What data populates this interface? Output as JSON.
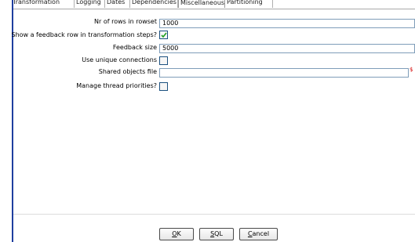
{
  "tabs": [
    {
      "label": "Transformation"
    },
    {
      "label": "Logging"
    },
    {
      "label": "Dates"
    },
    {
      "label": "Dependencies"
    },
    {
      "label": "Miscellaneous",
      "selected": true
    },
    {
      "label": "Partitioning"
    }
  ],
  "form": {
    "rows_in_rowset_label": "Nr of rows in rowset",
    "rows_in_rowset_value": "1000",
    "feedback_row_label": "Show a feedback row in transformation steps?",
    "feedback_row_checked": true,
    "feedback_size_label": "Feedback size",
    "feedback_size_value": "5000",
    "unique_connections_label": "Use unique connections",
    "unique_connections_checked": false,
    "shared_objects_label": "Shared objects file",
    "shared_objects_value": "",
    "variable_icon": "$",
    "thread_priorities_label": "Manage thread priorities?",
    "thread_priorities_checked": false
  },
  "buttons": {
    "ok_mnemonic": "O",
    "ok_rest": "K",
    "sql_mnemonic": "S",
    "sql_rest": "QL",
    "cancel_mnemonic": "C",
    "cancel_rest": "ancel"
  },
  "colors": {
    "window_border": "#1f3f9f",
    "field_border": "#7f9db9",
    "variable_icon": "#d40000"
  }
}
